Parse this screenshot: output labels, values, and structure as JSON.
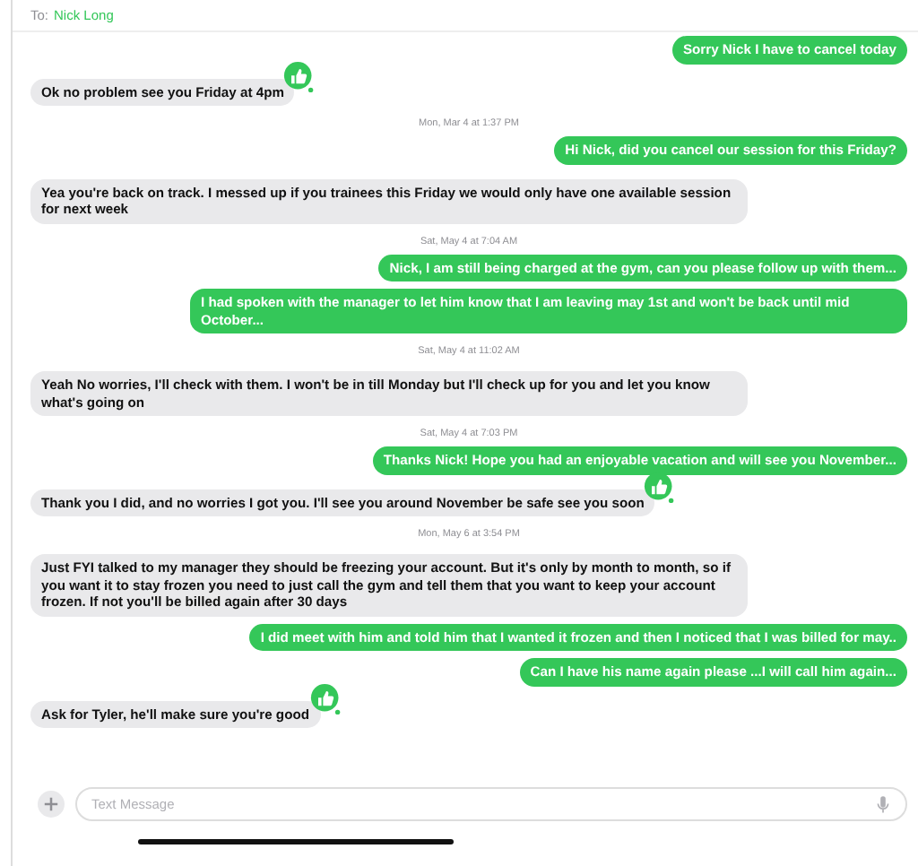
{
  "header": {
    "to_label": "To:",
    "recipient": "Nick Long"
  },
  "messages": [
    {
      "kind": "sent",
      "text": "Sorry Nick I have to cancel today",
      "reaction": false
    },
    {
      "kind": "received",
      "text": "Ok no problem see you Friday at 4pm",
      "reaction": true
    },
    {
      "kind": "timestamp",
      "text": "Mon, Mar 4 at 1:37 PM"
    },
    {
      "kind": "sent",
      "text": "Hi Nick, did you cancel our session for this Friday?",
      "reaction": false
    },
    {
      "kind": "received",
      "text": "Yea you're back on track. I messed up if you trainees this Friday we would only have one available session for next week",
      "reaction": false
    },
    {
      "kind": "timestamp",
      "text": "Sat, May 4 at 7:04 AM"
    },
    {
      "kind": "sent",
      "text": "Nick, I am still being charged at the gym, can you please follow up with them...",
      "reaction": false
    },
    {
      "kind": "sent",
      "text": "I had spoken with the manager to let him know that I am leaving may 1st and won't be back until mid October...",
      "reaction": false
    },
    {
      "kind": "timestamp",
      "text": "Sat, May 4 at 11:02 AM"
    },
    {
      "kind": "received",
      "text": "Yeah No worries, I'll check with them. I won't be in till Monday but I'll check up for you and let you know what's going on",
      "reaction": false
    },
    {
      "kind": "timestamp",
      "text": "Sat, May 4 at 7:03 PM"
    },
    {
      "kind": "sent",
      "text": "Thanks Nick! Hope you had an enjoyable vacation and will see you November...",
      "reaction": false
    },
    {
      "kind": "received",
      "text": "Thank you I did, and no worries I got you. I'll see you around November be safe see you soon",
      "reaction": true
    },
    {
      "kind": "timestamp",
      "text": "Mon, May 6 at 3:54 PM"
    },
    {
      "kind": "received",
      "text": "Just FYI talked to my manager they should be freezing your account. But it's only by month to month, so if you want it to stay frozen you need to just call the gym and tell them that you want to keep your account frozen. If not you'll be billed again after 30 days",
      "reaction": false
    },
    {
      "kind": "sent",
      "text": "I did meet with him and told him that I wanted it frozen and then I noticed that I was billed for may..",
      "reaction": false
    },
    {
      "kind": "sent",
      "text": "Can I have his name again please ...I will call him again...",
      "reaction": false
    },
    {
      "kind": "received",
      "text": "Ask for Tyler, he'll make sure you're good",
      "reaction": true
    }
  ],
  "composer": {
    "placeholder": "Text Message"
  }
}
